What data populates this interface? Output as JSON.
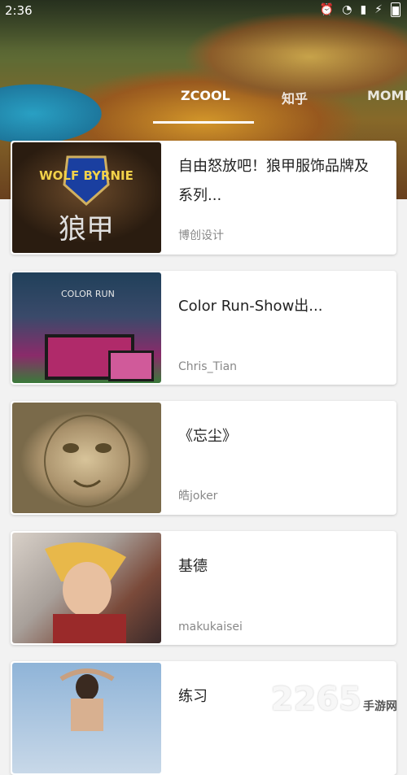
{
  "status_bar": {
    "time": "2:36",
    "icons": [
      "alarm-icon",
      "wifi-icon",
      "signal-icon",
      "charging-icon",
      "battery-icon"
    ]
  },
  "tabs": [
    {
      "label": "ZCOOL",
      "selected": true
    },
    {
      "label": "知乎"
    },
    {
      "label": "MOME"
    }
  ],
  "cards": [
    {
      "title": "自由怒放吧！狼甲服饰品牌及系列...",
      "author": "博创设计",
      "thumb_text": "狼甲",
      "thumb_badge": "WOLF BYRNIE"
    },
    {
      "title": "Color Run-Show出...",
      "author": "Chris_Tian",
      "thumb_text": "COLOR RUN"
    },
    {
      "title": "《忘尘》",
      "author": "皓joker"
    },
    {
      "title": "基德",
      "author": "makukaisei"
    },
    {
      "title": "练习",
      "author": ""
    }
  ],
  "watermark": {
    "big": "2265",
    "small": "手游网"
  }
}
